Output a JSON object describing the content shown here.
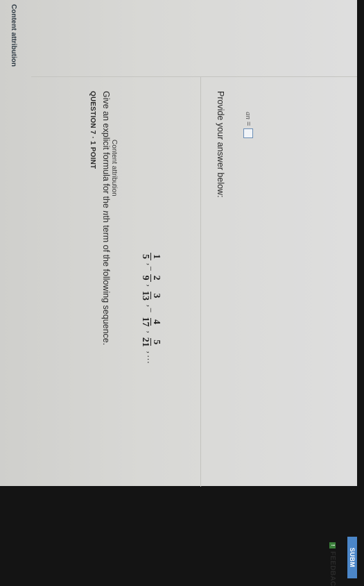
{
  "header": {
    "attribution": "Content attribution"
  },
  "question": {
    "label": "QUESTION 7 · 1 POINT",
    "prompt_before": "Give an explicit formula for the ",
    "prompt_var": "n",
    "prompt_after": "th term of the following sequence.",
    "sequence": [
      {
        "sign": "",
        "num": "1",
        "den": "5"
      },
      {
        "sign": "−",
        "num": "2",
        "den": "9"
      },
      {
        "sign": "",
        "num": "3",
        "den": "13"
      },
      {
        "sign": "−",
        "num": "4",
        "den": "17"
      },
      {
        "sign": "",
        "num": "5",
        "den": "21"
      }
    ],
    "ellipsis": "…"
  },
  "answer": {
    "instruction": "Provide your answer below:",
    "label": "an",
    "equals": "="
  },
  "footer": {
    "attribution": "Content attribution",
    "feedback_label": "FEEDBAC",
    "submit_label": "SUBM"
  }
}
